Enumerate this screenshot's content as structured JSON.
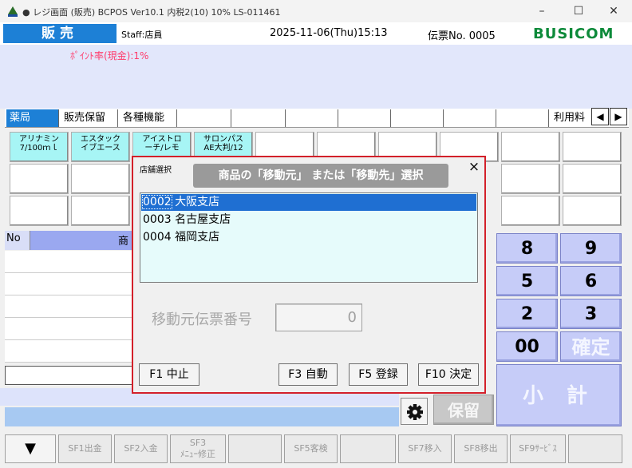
{
  "window": {
    "title": "● レジ画面 (販売)  BCPOS Ver10.1  内税2(10) 10%  LS-011461",
    "minimize": "–",
    "maximize": "☐",
    "close": "✕"
  },
  "header": {
    "mode": "販売",
    "staff": "Staff:店員",
    "datetime": "2025-11-06(Thu)15:13",
    "slip_no": "伝票No. 0005",
    "logo": "BUSICOM",
    "points_rate": "ﾎﾟｲﾝﾄ率(現金):1%"
  },
  "tabs": [
    "薬局",
    "販売保留",
    "各種機能"
  ],
  "tab_right_label": "利用料",
  "tab_left_arrow": "◀",
  "tab_right_arrow": "▶",
  "products": [
    [
      "アリナミン",
      "7/100ｍｌ"
    ],
    [
      "エスタック",
      "イブエース"
    ],
    [
      "アイストロ",
      "ーチ/レモ"
    ],
    [
      "サロンパス",
      "AE大判/12"
    ]
  ],
  "list_header": {
    "no": "No",
    "product": "商"
  },
  "keypad": {
    "row1": [
      "8",
      "9"
    ],
    "row2": [
      "5",
      "6"
    ],
    "row3": [
      "2",
      "3"
    ],
    "row4": [
      "00",
      "確定"
    ],
    "subtotal": "小 計",
    "hold": "保留"
  },
  "footer": {
    "down": "▼",
    "keys": [
      "SF1出金",
      "SF2入金",
      "SF3\nﾒﾆｭｰ修正",
      "",
      "SF5客検",
      "",
      "SF7移入",
      "SF8移出",
      "SF9ｻｰﾋﾞｽ",
      ""
    ]
  },
  "dialog": {
    "caption": "店舗選択",
    "title": "商品の「移動元」 または「移動先」選択",
    "close": "×",
    "stores": [
      {
        "code": "0002",
        "name": "大阪支店",
        "selected": true
      },
      {
        "code": "0003",
        "name": "名古屋支店",
        "selected": false
      },
      {
        "code": "0004",
        "name": "福岡支店",
        "selected": false
      }
    ],
    "source_slip_label": "移動元伝票番号",
    "source_slip_value": "0",
    "buttons": {
      "cancel": "F1 中止",
      "auto": "F3 自動",
      "register": "F5 登録",
      "decide": "F10 決定"
    }
  }
}
